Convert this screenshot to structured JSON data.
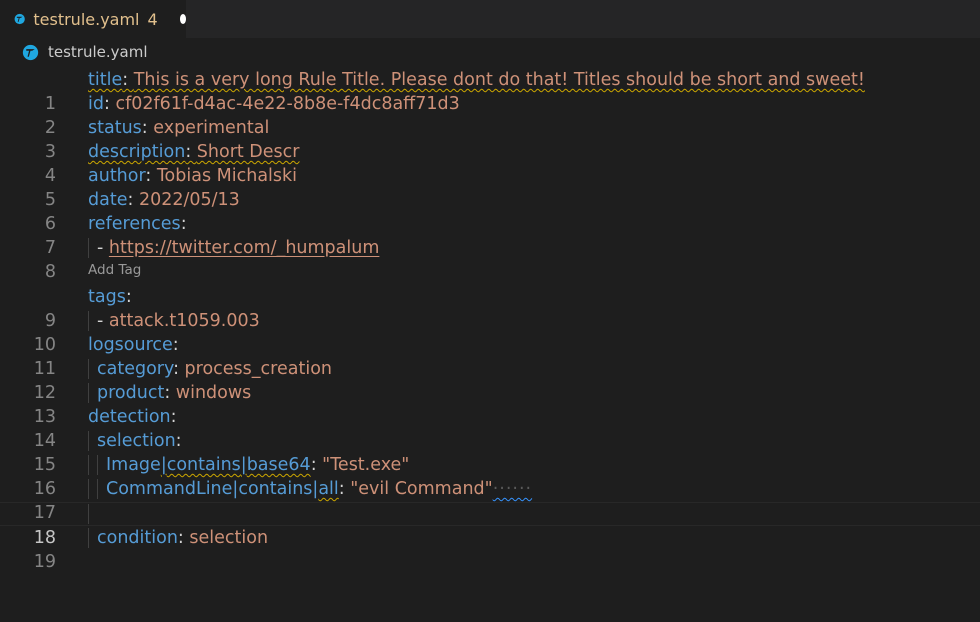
{
  "tab": {
    "filename": "testrule.yaml",
    "problem_count": "4",
    "icon": "file-type-icon"
  },
  "breadcrumb": {
    "filename": "testrule.yaml"
  },
  "codelens": {
    "label": "Add Tag"
  },
  "lines": {
    "l1": {
      "num": "1",
      "key": "title",
      "value": "This is a very long Rule Title. Please dont do that! Titles should be short and sweet!"
    },
    "l2": {
      "num": "2",
      "key": "id",
      "value": "cf02f61f-d4ac-4e22-8b8e-f4dc8aff71d3"
    },
    "l3": {
      "num": "3",
      "key": "status",
      "value": "experimental"
    },
    "l4": {
      "num": "4",
      "key": "description",
      "value": "Short Descr"
    },
    "l5": {
      "num": "5",
      "key": "author",
      "value": "Tobias Michalski"
    },
    "l6": {
      "num": "6",
      "key": "date",
      "value": "2022/05/13"
    },
    "l7": {
      "num": "7",
      "key": "references"
    },
    "l8": {
      "num": "8",
      "dash": "- ",
      "value": "https://twitter.com/_humpalum"
    },
    "l9": {
      "num": "9",
      "key": "tags"
    },
    "l10": {
      "num": "10",
      "dash": "- ",
      "value": "attack.t1059.003"
    },
    "l11": {
      "num": "11",
      "key": "logsource"
    },
    "l12": {
      "num": "12",
      "key": "category",
      "value": "process_creation"
    },
    "l13": {
      "num": "13",
      "key": "product",
      "value": "windows"
    },
    "l14": {
      "num": "14",
      "key": "detection"
    },
    "l15": {
      "num": "15",
      "key": "selection"
    },
    "l16": {
      "num": "16",
      "key_a": "Image",
      "key_b": "contains",
      "key_c": "base64",
      "value": "\"Test.exe\""
    },
    "l17": {
      "num": "17",
      "key_a": "CommandLine",
      "key_b": "contains",
      "key_c": "all",
      "value": "\"evil Command\""
    },
    "l18": {
      "num": "18"
    },
    "l19": {
      "num": "19",
      "key": "condition",
      "value": "selection"
    }
  },
  "colors": {
    "key": "#569cd6",
    "value": "#ce9178",
    "warning": "#cca700",
    "info": "#3794ff",
    "tab_modified": "#e2c08d"
  }
}
